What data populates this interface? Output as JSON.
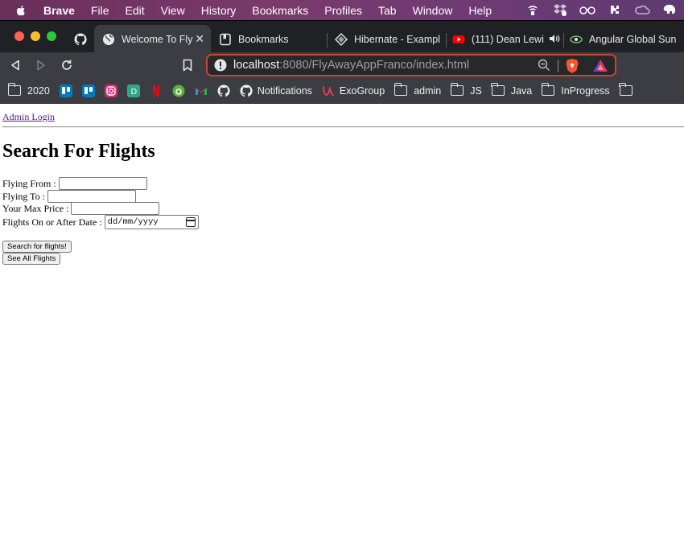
{
  "menubar": {
    "app_name": "Brave",
    "items": [
      "File",
      "Edit",
      "View",
      "History",
      "Bookmarks",
      "Profiles",
      "Tab",
      "Window",
      "Help"
    ]
  },
  "tabs": [
    {
      "title": "Welcome To Fly",
      "icon": "globe-icon",
      "active": true
    },
    {
      "title": "Bookmarks",
      "icon": "bookmark-icon",
      "active": false
    },
    {
      "title": "Hibernate - Exampl",
      "icon": "hibernate-icon",
      "active": false
    },
    {
      "title": "(111) Dean Lewi",
      "icon": "youtube-icon",
      "active": false
    },
    {
      "title": "Angular Global Sun",
      "icon": "angular-icon",
      "active": false
    }
  ],
  "urlbar": {
    "host": "localhost",
    "path": ":8080/FlyAwayAppFranco/index.html"
  },
  "bookmarks": [
    {
      "label": "2020",
      "icon": "folder-icon"
    },
    {
      "label": "",
      "icon": "trello-icon"
    },
    {
      "label": "",
      "icon": "trello-icon"
    },
    {
      "label": "",
      "icon": "instagram-icon"
    },
    {
      "label": "",
      "icon": "d-app-icon"
    },
    {
      "label": "",
      "icon": "netflix-icon"
    },
    {
      "label": "",
      "icon": "green-app-icon"
    },
    {
      "label": "",
      "icon": "gmail-icon"
    },
    {
      "label": "",
      "icon": "github-icon"
    },
    {
      "label": "Notifications",
      "icon": "github-icon"
    },
    {
      "label": "ExoGroup",
      "icon": "exogroup-icon"
    },
    {
      "label": "admin",
      "icon": "folder-icon"
    },
    {
      "label": "JS",
      "icon": "folder-icon"
    },
    {
      "label": "Java",
      "icon": "folder-icon"
    },
    {
      "label": "InProgress",
      "icon": "folder-icon"
    }
  ],
  "page": {
    "admin_link": "Admin Login",
    "heading": "Search For Flights",
    "form": {
      "flying_from_label": "Flying From :",
      "flying_to_label": "Flying To :",
      "max_price_label": "Your Max Price :",
      "date_label": "Flights On or After Date :",
      "date_placeholder": "dd/mm/yyyy",
      "search_button": "Search for flights!",
      "see_all_button": "See All Flights"
    }
  },
  "colors": {
    "menubar_bg": "#6e3a6c",
    "tabstrip_bg": "#1f2125",
    "toolbar_bg": "#3b3d42",
    "url_focus_border": "#c8462e",
    "link_visited": "#551a8b"
  }
}
